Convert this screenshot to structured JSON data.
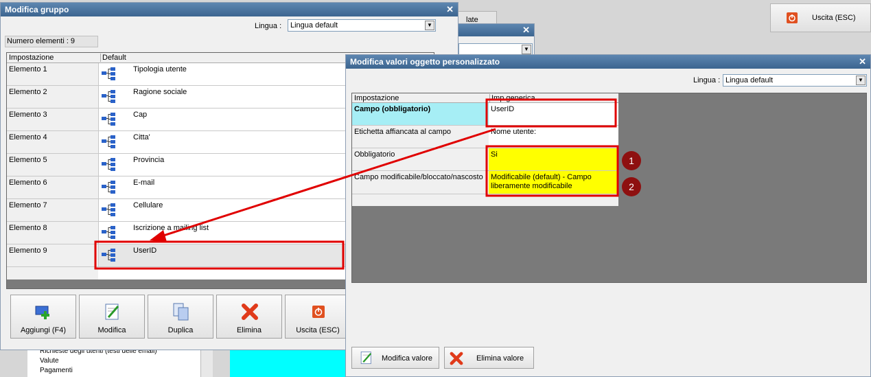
{
  "background_window": {
    "exit_button_label": "Uscita (ESC)",
    "partial_tab_text": "late",
    "tree_items": [
      "Richieste degli utenti (testi delle email)",
      "Valute",
      "Pagamenti"
    ]
  },
  "group_window": {
    "title": "Modifica gruppo",
    "language_label": "Lingua :",
    "language_value": "Lingua default",
    "count_label": "Numero elementi : 9",
    "columns": [
      "Impostazione",
      "Default"
    ],
    "rows": [
      {
        "name": "Elemento 1",
        "value": "Tipologia utente"
      },
      {
        "name": "Elemento 2",
        "value": "Ragione sociale"
      },
      {
        "name": "Elemento 3",
        "value": "Cap"
      },
      {
        "name": "Elemento 4",
        "value": "Citta'"
      },
      {
        "name": "Elemento 5",
        "value": "Provincia"
      },
      {
        "name": "Elemento 6",
        "value": "E-mail"
      },
      {
        "name": "Elemento 7",
        "value": "Cellulare"
      },
      {
        "name": "Elemento 8",
        "value": "Iscrizione a mailing list"
      },
      {
        "name": "Elemento 9",
        "value": "UserID"
      }
    ],
    "buttons": [
      "Aggiungi (F4)",
      "Modifica",
      "Duplica",
      "Elimina",
      "Uscita (ESC)"
    ]
  },
  "value_window": {
    "title": "Modifica valori oggetto personalizzato",
    "language_label": "Lingua :",
    "language_value": "Lingua default",
    "columns": [
      "Impostazione",
      "Imp.generica"
    ],
    "rows": [
      {
        "name": "Campo (obbligatorio)",
        "value": "UserID"
      },
      {
        "name": "Etichetta affiancata al campo",
        "value": "Nome utente:"
      },
      {
        "name": "Obbligatorio",
        "value": "Si"
      },
      {
        "name": "Campo modificabile/bloccato/nascosto",
        "value": "Modificabile (default) - Campo liberamente modificabile"
      }
    ],
    "buttons": [
      "Modifica valore",
      "Elimina valore"
    ]
  },
  "annotations": {
    "badge1": "1",
    "badge2": "2"
  },
  "colors": {
    "title_bar": "#4a73a0",
    "highlight_red": "#e00000",
    "yellow": "#ffff00",
    "cyan_cell": "#a6eef5",
    "badge": "#8e1010"
  }
}
